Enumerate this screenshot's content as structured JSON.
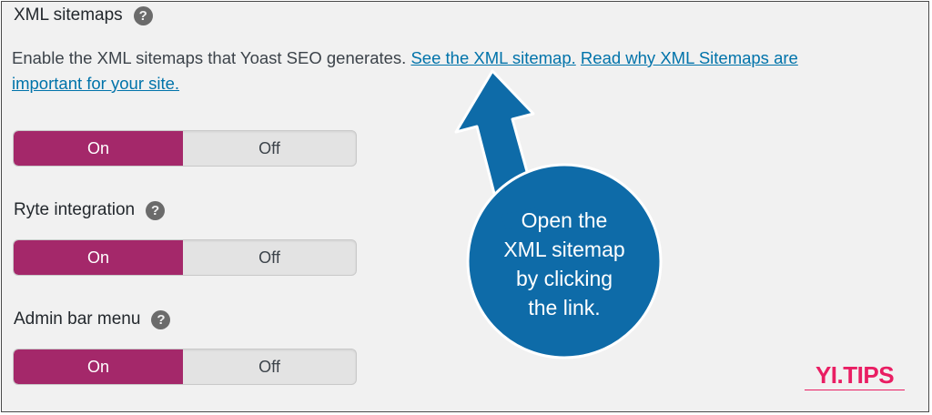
{
  "sections": {
    "xml_sitemaps": {
      "title": "XML sitemaps",
      "toggle_on": "On",
      "toggle_off": "Off",
      "selected": "On"
    },
    "ryte": {
      "title": "Ryte integration",
      "toggle_on": "On",
      "toggle_off": "Off",
      "selected": "On"
    },
    "admin_bar": {
      "title": "Admin bar menu",
      "toggle_on": "On",
      "toggle_off": "Off",
      "selected": "On"
    }
  },
  "description": {
    "text": "Enable the XML sitemaps that Yoast SEO generates.",
    "link1": "See the XML sitemap.",
    "link2": "Read why XML Sitemaps are important for your site."
  },
  "help_icon_glyph": "?",
  "callout": {
    "line1": "Open the",
    "line2": "XML sitemap",
    "line3": "by clicking",
    "line4": "the link.",
    "color": "#0e6ba8"
  },
  "brand": {
    "logo": "YI.TIPS"
  },
  "colors": {
    "toggle_on": "#a4286a",
    "link": "#0073aa",
    "brand": "#e91e63"
  }
}
